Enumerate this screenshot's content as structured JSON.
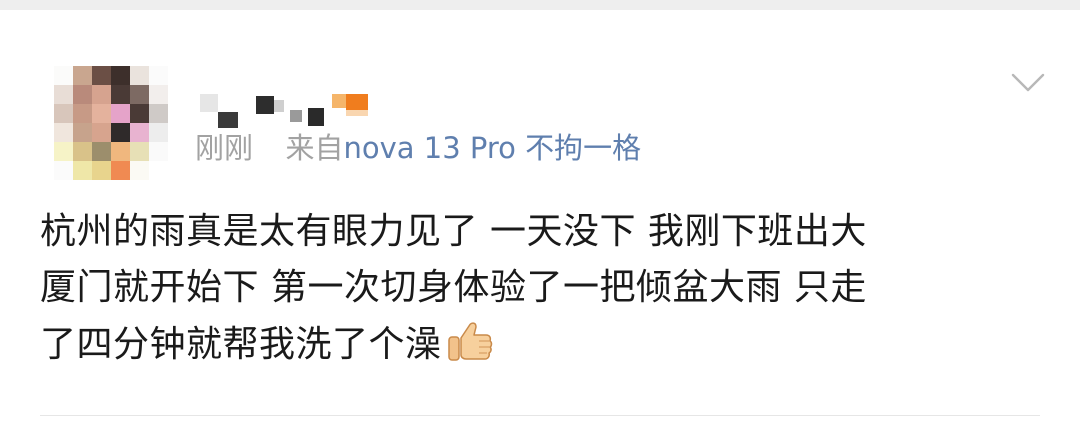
{
  "post": {
    "timestamp": "刚刚",
    "source_prefix": "来自",
    "source_device": "nova 13 Pro 不拘一格",
    "content_lines": [
      "杭州的雨真是太有眼力见了 一天没下 我刚下班出大",
      "厦门就开始下 第一次切身体验了一把倾盆大雨 只走",
      "了四分钟就帮我洗了个澡"
    ],
    "emoji": "thumbs-up-icon"
  },
  "colors": {
    "meta_gray": "#a2a2a2",
    "source_blue": "#5f7fae",
    "text": "#1a1a1a"
  }
}
